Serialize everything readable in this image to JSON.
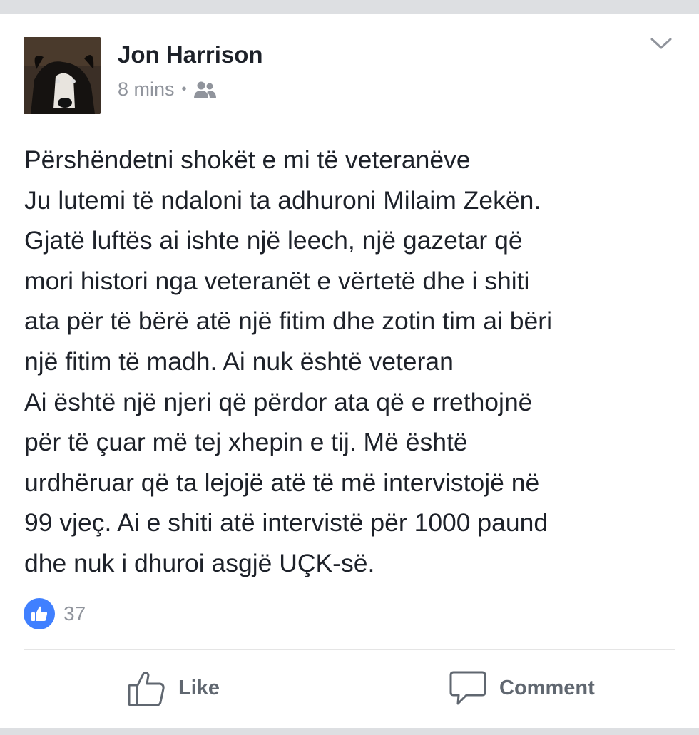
{
  "post": {
    "author": "Jon Harrison",
    "time": "8 mins",
    "audience_icon": "friends-icon",
    "lines": [
      "Përshëndetni shokët e mi të veteranëve",
      "Ju lutemi të ndaloni ta adhuroni Milaim Zekën.",
      "Gjatë luftës ai ishte një leech, një gazetar që",
      "mori histori nga veteranët e vërtetë dhe i shiti",
      "ata për të bërë atë një fitim dhe zotin tim ai bëri",
      "një fitim të madh. Ai nuk është veteran",
      "Ai është një njeri që përdor ata që e rrethojnë",
      "për të çuar më tej xhepin e tij. Më është",
      "urdhëruar që ta lejojë atë të më intervistojë në",
      "99 vjeç. Ai e shiti atë intervistë për 1000 paund",
      "dhe nuk i dhuroi asgjë UÇK-së."
    ],
    "reaction_count": "37"
  },
  "actions": {
    "like_label": "Like",
    "comment_label": "Comment"
  },
  "colors": {
    "like_blue": "#4080ff",
    "text_dark": "#1d2129",
    "text_gray": "#90949c"
  }
}
